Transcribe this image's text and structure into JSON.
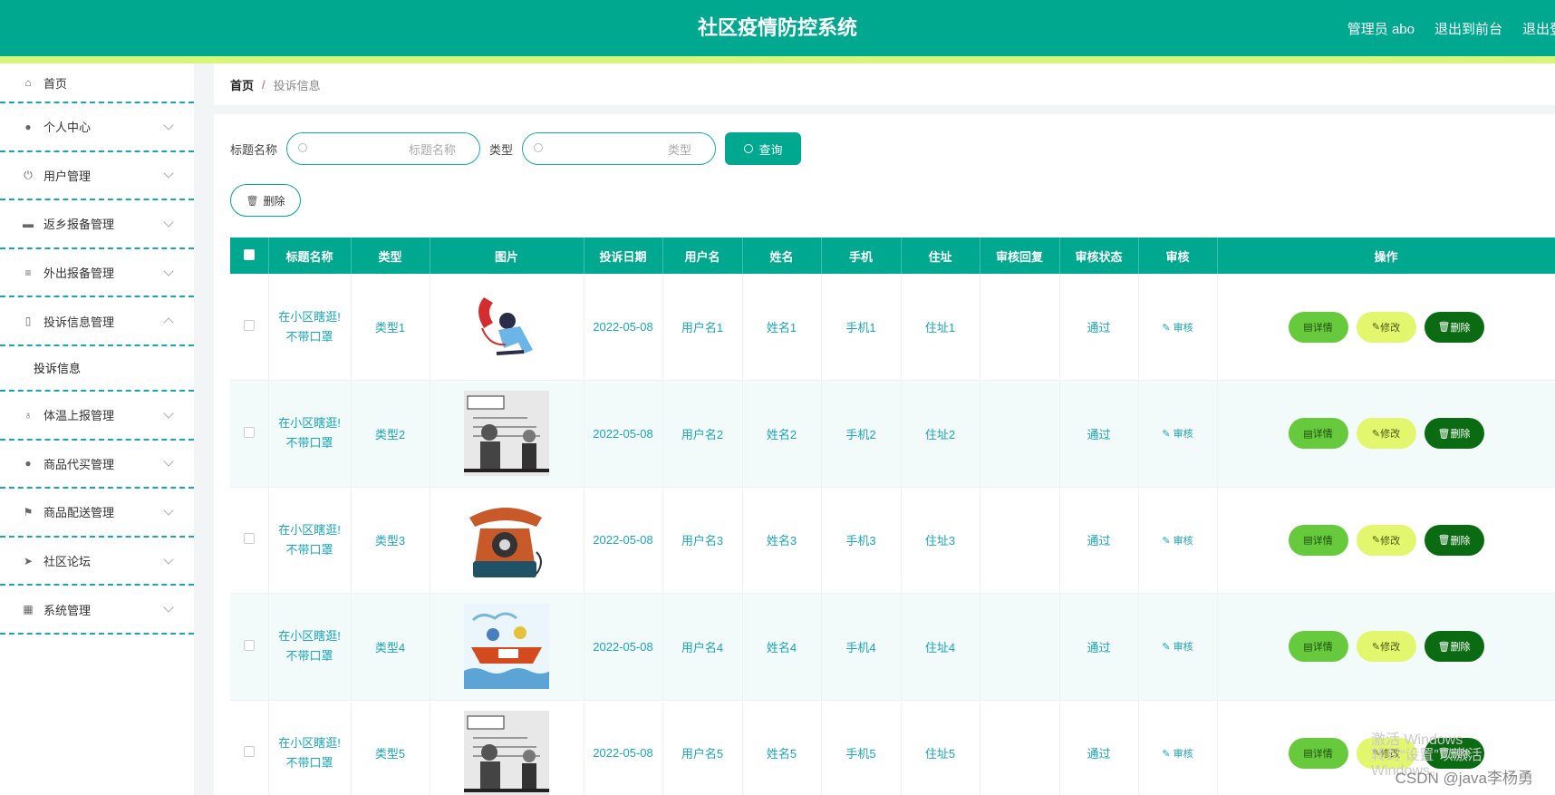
{
  "header": {
    "title": "社区疫情防控系统",
    "links": [
      "管理员 abo",
      "退出到前台",
      "退出登录"
    ]
  },
  "sidebar": {
    "items": [
      {
        "label": "首页",
        "icon": "home-icon"
      },
      {
        "label": "个人中心",
        "icon": "user-icon"
      },
      {
        "label": "用户管理",
        "icon": "power-icon"
      },
      {
        "label": "返乡报备管理",
        "icon": "chat-icon"
      },
      {
        "label": "外出报备管理",
        "icon": "list-icon"
      },
      {
        "label": "投诉信息管理",
        "icon": "phone-icon"
      },
      {
        "label": "体温上报管理",
        "icon": "mic-icon"
      },
      {
        "label": "商品代买管理",
        "icon": "user-icon"
      },
      {
        "label": "商品配送管理",
        "icon": "flag-icon"
      },
      {
        "label": "社区论坛",
        "icon": "send-icon"
      },
      {
        "label": "系统管理",
        "icon": "chart-icon"
      }
    ],
    "submenu": "投诉信息"
  },
  "breadcrumb": {
    "home": "首页",
    "sep": "/",
    "current": "投诉信息"
  },
  "search": {
    "title_label": "标题名称",
    "title_placeholder": "标题名称",
    "type_label": "类型",
    "type_placeholder": "类型",
    "button": "查询"
  },
  "toolbar": {
    "delete": "删除"
  },
  "table": {
    "columns": [
      "标题名称",
      "类型",
      "图片",
      "投诉日期",
      "用户名",
      "姓名",
      "手机",
      "住址",
      "审核回复",
      "审核状态",
      "审核",
      "操作"
    ],
    "rows": [
      {
        "title": "在小区瞎逛!不带口罩",
        "type": "类型1",
        "date": "2022-05-08",
        "username": "用户名1",
        "name": "姓名1",
        "phone": "手机1",
        "address": "住址1",
        "reply": "",
        "status": "通过",
        "image": "phone-man"
      },
      {
        "title": "在小区瞎逛!不带口罩",
        "type": "类型2",
        "date": "2022-05-08",
        "username": "用户名2",
        "name": "姓名2",
        "phone": "手机2",
        "address": "住址2",
        "reply": "",
        "status": "通过",
        "image": "comic"
      },
      {
        "title": "在小区瞎逛!不带口罩",
        "type": "类型3",
        "date": "2022-05-08",
        "username": "用户名3",
        "name": "姓名3",
        "phone": "手机3",
        "address": "住址3",
        "reply": "",
        "status": "通过",
        "image": "telephone"
      },
      {
        "title": "在小区瞎逛!不带口罩",
        "type": "类型4",
        "date": "2022-05-08",
        "username": "用户名4",
        "name": "姓名4",
        "phone": "手机4",
        "address": "住址4",
        "reply": "",
        "status": "通过",
        "image": "boat"
      },
      {
        "title": "在小区瞎逛!不带口罩",
        "type": "类型5",
        "date": "2022-05-08",
        "username": "用户名5",
        "name": "姓名5",
        "phone": "手机5",
        "address": "住址5",
        "reply": "",
        "status": "通过",
        "image": "comic"
      }
    ],
    "audit_label": "审核",
    "actions": {
      "detail": "详情",
      "edit": "修改",
      "delete": "删除"
    }
  },
  "overlay": {
    "windows_line1": "激活 Windows",
    "windows_line2": "转到“设置”以激活 Windows。",
    "csdn": "CSDN @java李杨勇"
  },
  "colors": {
    "primary": "#00a88f",
    "accent_strip": "#d8f77a",
    "detail": "#67c93c",
    "edit": "#e3f76e",
    "delete": "#0b6b13"
  }
}
